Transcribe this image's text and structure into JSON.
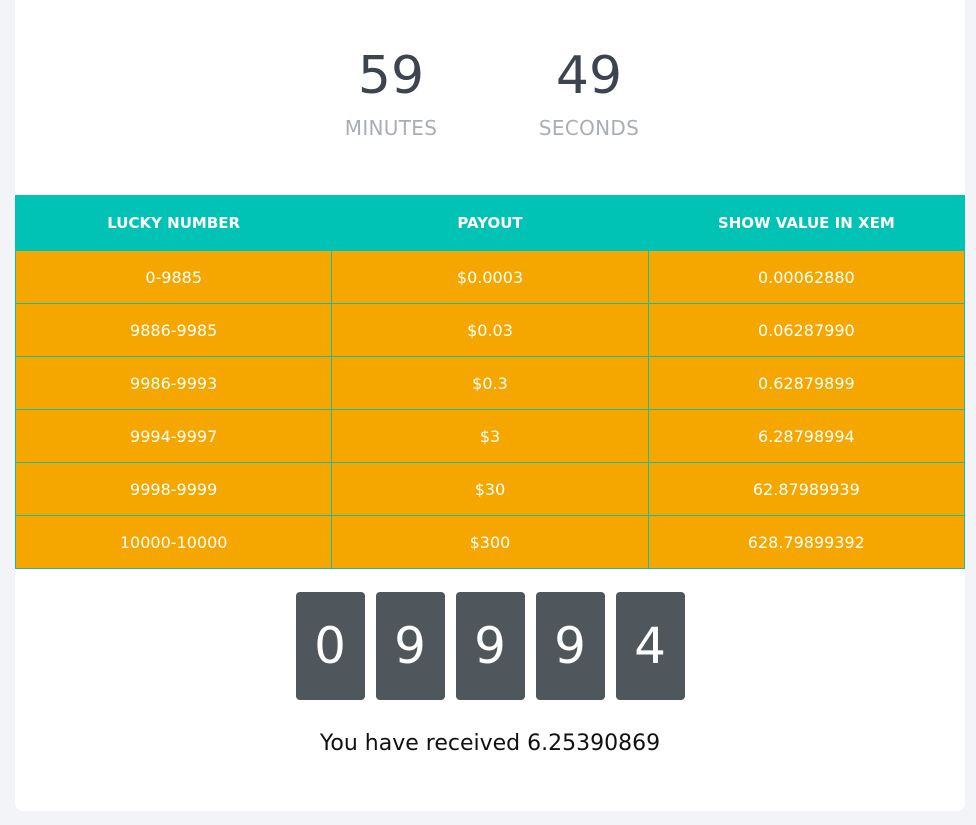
{
  "timer": {
    "minutes_value": "59",
    "minutes_label": "MINUTES",
    "seconds_value": "49",
    "seconds_label": "SECONDS"
  },
  "table": {
    "headers": [
      "LUCKY NUMBER",
      "PAYOUT",
      "SHOW VALUE IN XEM"
    ],
    "rows": [
      [
        "0-9885",
        "$0.0003",
        "0.00062880"
      ],
      [
        "9886-9985",
        "$0.03",
        "0.06287990"
      ],
      [
        "9986-9993",
        "$0.3",
        "0.62879899"
      ],
      [
        "9994-9997",
        "$3",
        "6.28798994"
      ],
      [
        "9998-9999",
        "$30",
        "62.87989939"
      ],
      [
        "10000-10000",
        "$300",
        "628.79899392"
      ]
    ]
  },
  "lucky_digits": [
    "0",
    "9",
    "9",
    "9",
    "4"
  ],
  "result": {
    "message": "You have received 6.25390869"
  },
  "colors": {
    "header_bg": "#00c3b5",
    "row_bg": "#f5a700",
    "digit_bg": "#50575c"
  }
}
